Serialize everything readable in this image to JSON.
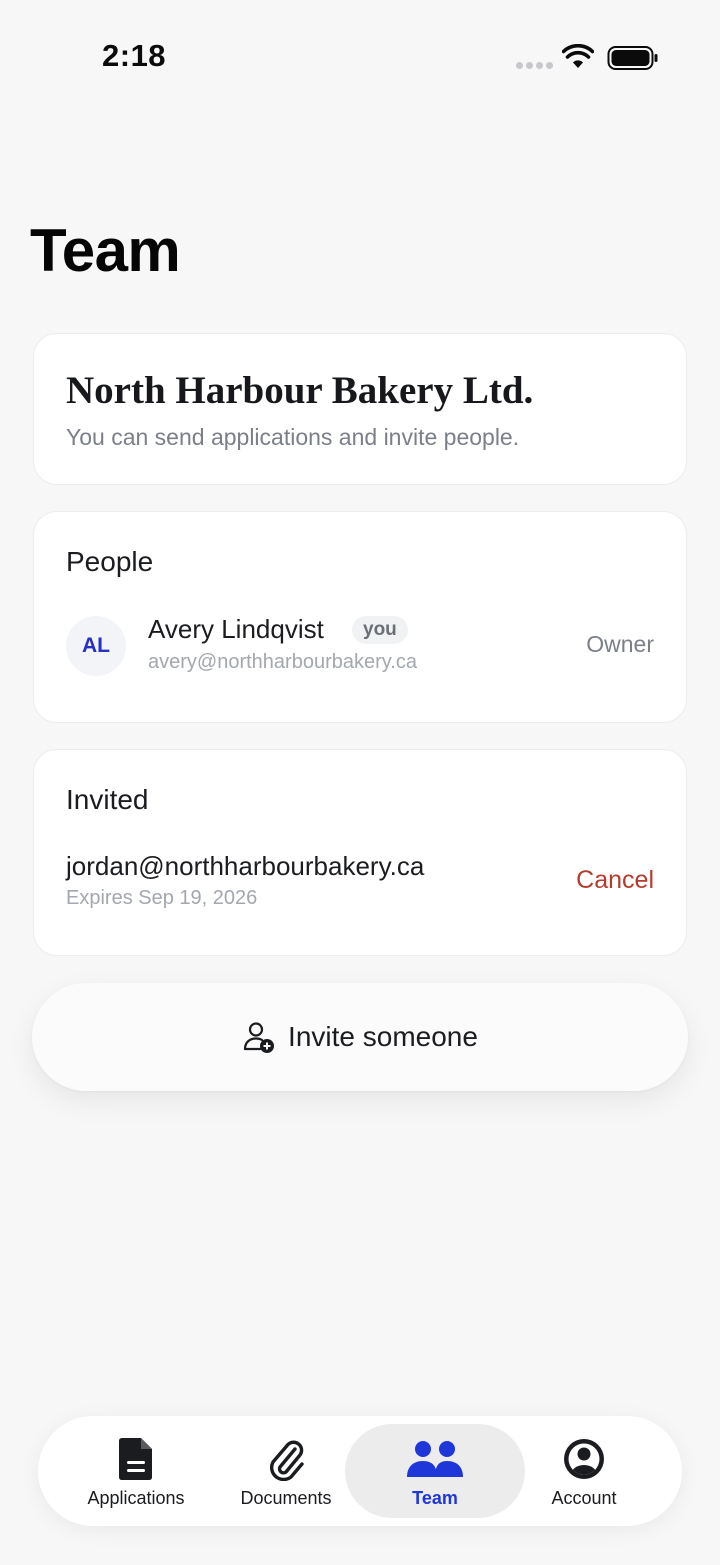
{
  "status_bar": {
    "time": "2:18"
  },
  "page": {
    "title": "Team"
  },
  "company": {
    "name": "North Harbour Bakery Ltd.",
    "subtitle": "You can send applications and invite people."
  },
  "people": {
    "title": "People",
    "members": [
      {
        "initials": "AL",
        "name": "Avery Lindqvist",
        "badge": "you",
        "email": "avery@northharbourbakery.ca",
        "role": "Owner"
      }
    ]
  },
  "invited": {
    "title": "Invited",
    "invites": [
      {
        "email": "jordan@northharbourbakery.ca",
        "expires": "Expires Sep 19, 2026",
        "action": "Cancel"
      }
    ]
  },
  "invite_button": {
    "label": "Invite someone",
    "icon": "user-plus-icon"
  },
  "tabs": [
    {
      "label": "Applications",
      "icon": "document-icon"
    },
    {
      "label": "Documents",
      "icon": "paperclip-icon"
    },
    {
      "label": "Team",
      "icon": "people-icon",
      "active": true
    },
    {
      "label": "Account",
      "icon": "account-circle-icon"
    }
  ],
  "colors": {
    "accent": "#1f36d9",
    "danger": "#b43c2f",
    "background": "#f7f7f8",
    "card": "#ffffff"
  }
}
